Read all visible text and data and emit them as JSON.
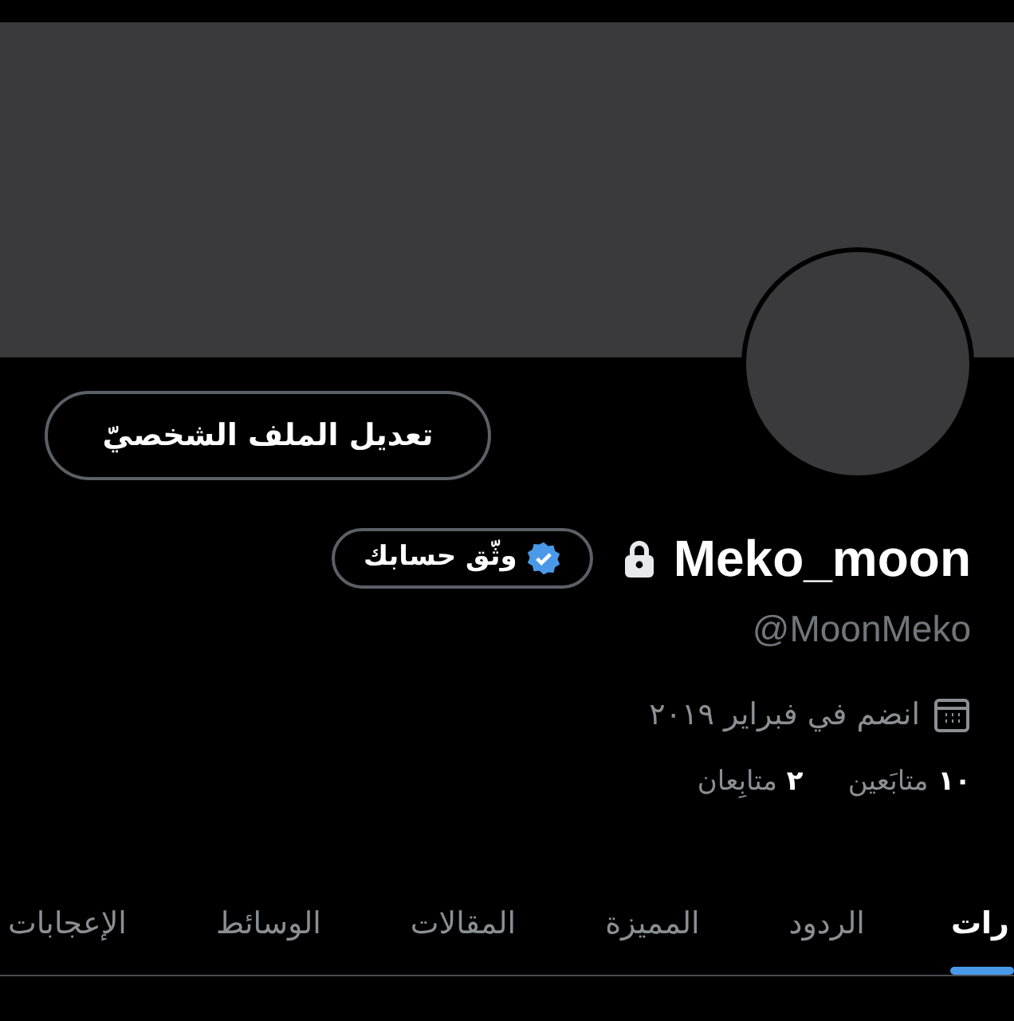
{
  "profile": {
    "edit_button": "تعديل الملف الشخصيّ",
    "display_name": "Meko_moon",
    "locked": true,
    "verify_button": "وثّق حسابك",
    "handle": "@MoonMeko",
    "joined": "انضم في فبراير ٢٠١٩",
    "following": {
      "count": "١٠",
      "label": "متابَعين"
    },
    "followers": {
      "count": "٢",
      "label": "متابِعان"
    }
  },
  "tabs": [
    {
      "label": "رات",
      "selected": true
    },
    {
      "label": "الردود",
      "selected": false
    },
    {
      "label": "المميزة",
      "selected": false
    },
    {
      "label": "المقالات",
      "selected": false
    },
    {
      "label": "الوسائط",
      "selected": false
    },
    {
      "label": "الإعجابات",
      "selected": false
    }
  ]
}
